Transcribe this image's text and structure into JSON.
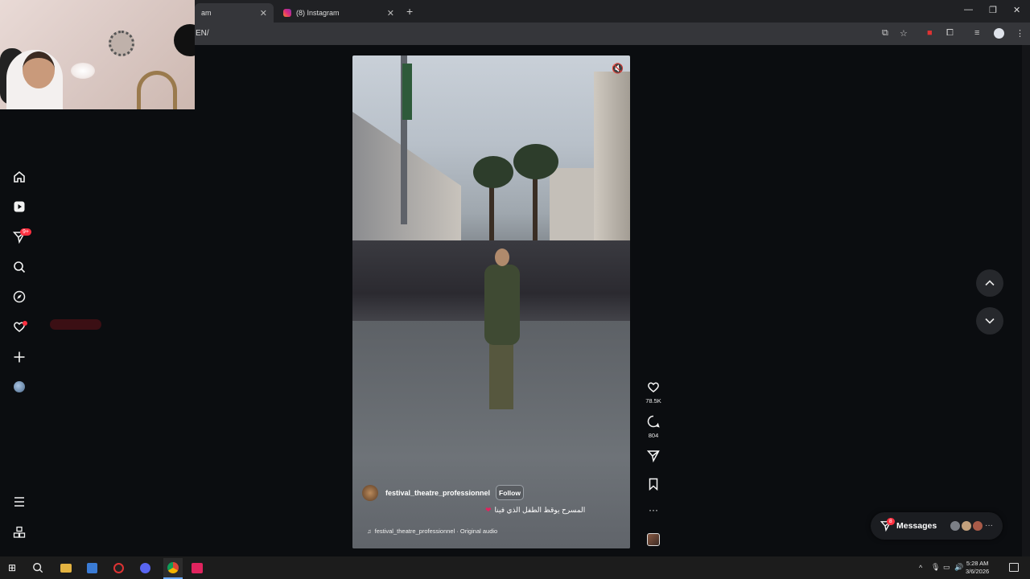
{
  "browser": {
    "tabs": [
      {
        "title": "am",
        "close": "✕"
      },
      {
        "title": "(8) Instagram",
        "close": "✕"
      }
    ],
    "new_tab": "+",
    "url": "EN/",
    "window_controls": [
      "—",
      "❐",
      "✕"
    ]
  },
  "nav": {
    "items": [
      {
        "name": "home-icon"
      },
      {
        "name": "reels-icon"
      },
      {
        "name": "direct-icon",
        "badge": "9+"
      },
      {
        "name": "search-icon"
      },
      {
        "name": "explore-icon"
      },
      {
        "name": "notifications-icon"
      },
      {
        "name": "create-icon"
      },
      {
        "name": "profile-avatar"
      }
    ],
    "more": "more-icon",
    "also_from_meta": "meta-apps-icon"
  },
  "reel": {
    "author": "festival_theatre_professionnel",
    "follow_label": "Follow",
    "caption": "المسرح يوقظ الطفل الذي فينا",
    "caption_emoji": "❤",
    "audio_label": "festival_theatre_professionnel · Original audio",
    "likes": "78.5K",
    "comments": "804"
  },
  "messages": {
    "label": "Messages",
    "badge": "8"
  },
  "taskbar": {
    "time": "5:28 AM",
    "date": "3/6/2026"
  },
  "colors": {
    "accent_red": "#ff3040",
    "background": "#0b0d10"
  }
}
